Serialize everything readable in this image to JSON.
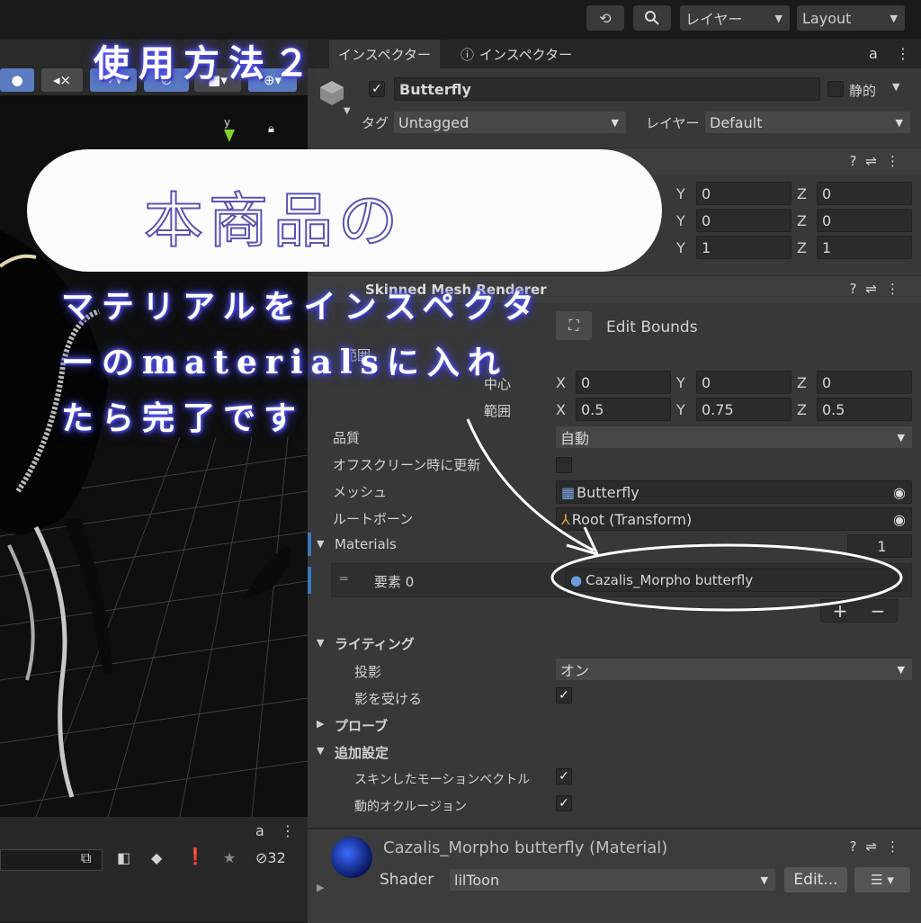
{
  "topbar": {
    "history_icon": "history-icon",
    "search_icon": "search-icon",
    "layer_dropdown": "レイヤー",
    "layout_dropdown": "Layout"
  },
  "overlay": {
    "step_label": "使用方法２",
    "title": "本商品の",
    "body_lines": [
      "マテリアルをインスペクタ",
      "ーのmaterialsに入れ",
      "たら完了です"
    ]
  },
  "inspector": {
    "tabs": [
      "インスペクター",
      "インスペクター"
    ],
    "object_name": "Butterfly",
    "static_label": "静的",
    "tag_label": "タグ",
    "tag_value": "Untagged",
    "layer_label": "レイヤー",
    "layer_value": "Default",
    "transform_rows": [
      {
        "y": "0",
        "z": "0"
      },
      {
        "y": "0",
        "z": "0"
      },
      {
        "y": "1",
        "z": "1"
      }
    ],
    "smr_title": "Skinned Mesh Renderer",
    "edit_bounds": "Edit Bounds",
    "bounds_label": "範囲",
    "center_label": "中心",
    "center": {
      "x": "0",
      "y": "0",
      "z": "0"
    },
    "extent_label": "範囲",
    "extent": {
      "x": "0.5",
      "y": "0.75",
      "z": "0.5"
    },
    "quality_label": "品質",
    "quality_value": "自動",
    "offscreen_label": "オフスクリーン時に更新",
    "mesh_label": "メッシュ",
    "mesh_value": "Butterfly",
    "rootbone_label": "ルートボーン",
    "rootbone_value": "Root (Transform)",
    "materials_label": "Materials",
    "materials_count": "1",
    "element_label": "要素 0",
    "element_value": "Cazalis_Morpho butterfly",
    "plus": "+",
    "minus": "−",
    "lighting_label": "ライティング",
    "shadow_cast_label": "投影",
    "shadow_cast_value": "オン",
    "shadow_receive_label": "影を受ける",
    "probes_label": "プローブ",
    "additional_label": "追加設定",
    "skinned_motion_label": "スキンしたモーションベクトル",
    "dynamic_occlusion_label": "動的オクルージョン",
    "material_title": "Cazalis_Morpho butterfly (Material)",
    "shader_label": "Shader",
    "shader_value": "lilToon",
    "edit_button": "Edit...",
    "axis_x": "X",
    "axis_y": "Y",
    "axis_z": "Z",
    "lock_icon": "lock-icon",
    "menu_icon": "kebab-menu-icon"
  },
  "bottom_panel": {
    "hidden_count": "32"
  },
  "colors": {
    "inspector_bg": "#383838",
    "field_bg": "#2b2b2b",
    "scene_button": "#5b7cc0",
    "glow": "#4a4ae0"
  }
}
